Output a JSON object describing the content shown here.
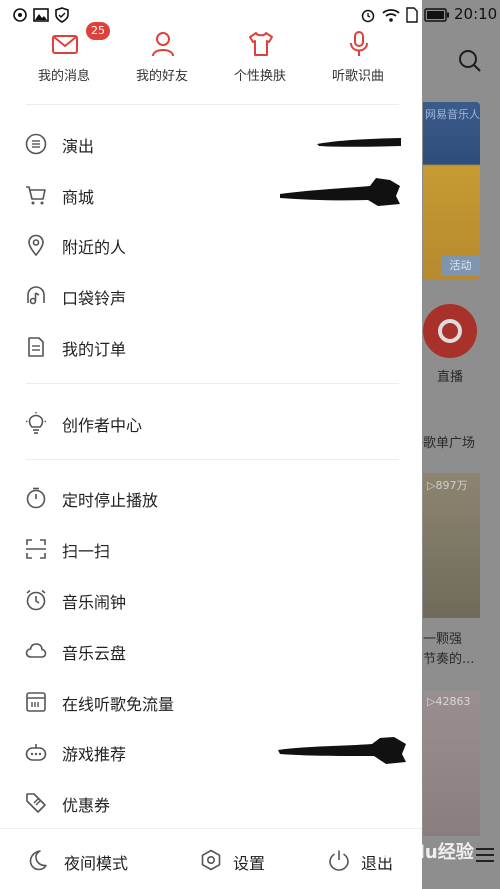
{
  "status_bar": {
    "time": "20:10"
  },
  "top_tiles": [
    {
      "label": "我的消息",
      "badge": "25",
      "icon": "mail-icon"
    },
    {
      "label": "我的好友",
      "icon": "person-icon"
    },
    {
      "label": "个性换肤",
      "icon": "tshirt-icon"
    },
    {
      "label": "听歌识曲",
      "icon": "microphone-icon"
    }
  ],
  "menu_group1": [
    {
      "label": "演出",
      "icon": "ticket-icon"
    },
    {
      "label": "商城",
      "icon": "cart-icon"
    },
    {
      "label": "附近的人",
      "icon": "location-icon"
    },
    {
      "label": "口袋铃声",
      "icon": "ringtone-icon"
    },
    {
      "label": "我的订单",
      "icon": "order-icon"
    }
  ],
  "menu_group2": [
    {
      "label": "创作者中心",
      "icon": "bulb-icon"
    }
  ],
  "menu_group3": [
    {
      "label": "定时停止播放",
      "icon": "timer-icon"
    },
    {
      "label": "扫一扫",
      "icon": "scan-icon"
    },
    {
      "label": "音乐闹钟",
      "icon": "alarm-icon"
    },
    {
      "label": "音乐云盘",
      "icon": "cloud-icon"
    },
    {
      "label": "在线听歌免流量",
      "icon": "sim-icon"
    },
    {
      "label": "游戏推荐",
      "icon": "gamepad-icon"
    },
    {
      "label": "优惠券",
      "icon": "coupon-icon"
    }
  ],
  "bottom_bar": {
    "night_mode": "夜间模式",
    "settings": "设置",
    "logout": "退出"
  },
  "background": {
    "banner_text": "网易音乐人",
    "banner_badge": "活动",
    "live_label": "直播",
    "section_title": "歌单广场",
    "card1_play": "▷897万",
    "card1_title_line1": "一颗强",
    "card1_title_line2": "节奏的...",
    "card2_play": "▷42863"
  },
  "watermark": "Baidu经验",
  "colors": {
    "accent": "#e0403a",
    "icon": "#555555"
  }
}
